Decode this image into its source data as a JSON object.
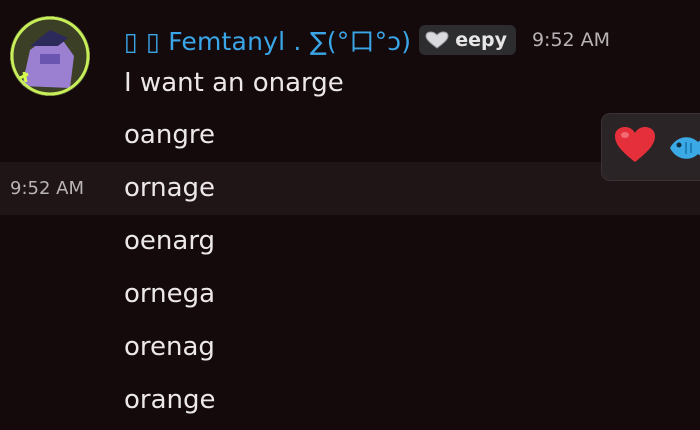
{
  "message_group": {
    "author": {
      "name": "▯ ▯ Femtanyl . ∑(°口°ɔ)",
      "tag": {
        "icon": "heart-icon",
        "label": "eepy"
      },
      "timestamp": "9:52 AM",
      "avatar": "avatar"
    },
    "messages": [
      {
        "text": "I want an onarge"
      },
      {
        "text": "oangre"
      },
      {
        "text": "ornage",
        "hover_time": "9:52 AM"
      },
      {
        "text": "oenarg"
      },
      {
        "text": "ornega"
      },
      {
        "text": "orenag"
      },
      {
        "text": "orange"
      }
    ]
  },
  "reaction_toolbar": {
    "items": [
      "red-heart-icon",
      "fish-icon"
    ]
  },
  "colors": {
    "background": "#140a0c",
    "username": "#3aa6e8",
    "hover_row": "#1f1517",
    "avatar_ring": "#c8ef5a",
    "heart": "#e5303b",
    "fish": "#3aa9e6"
  }
}
